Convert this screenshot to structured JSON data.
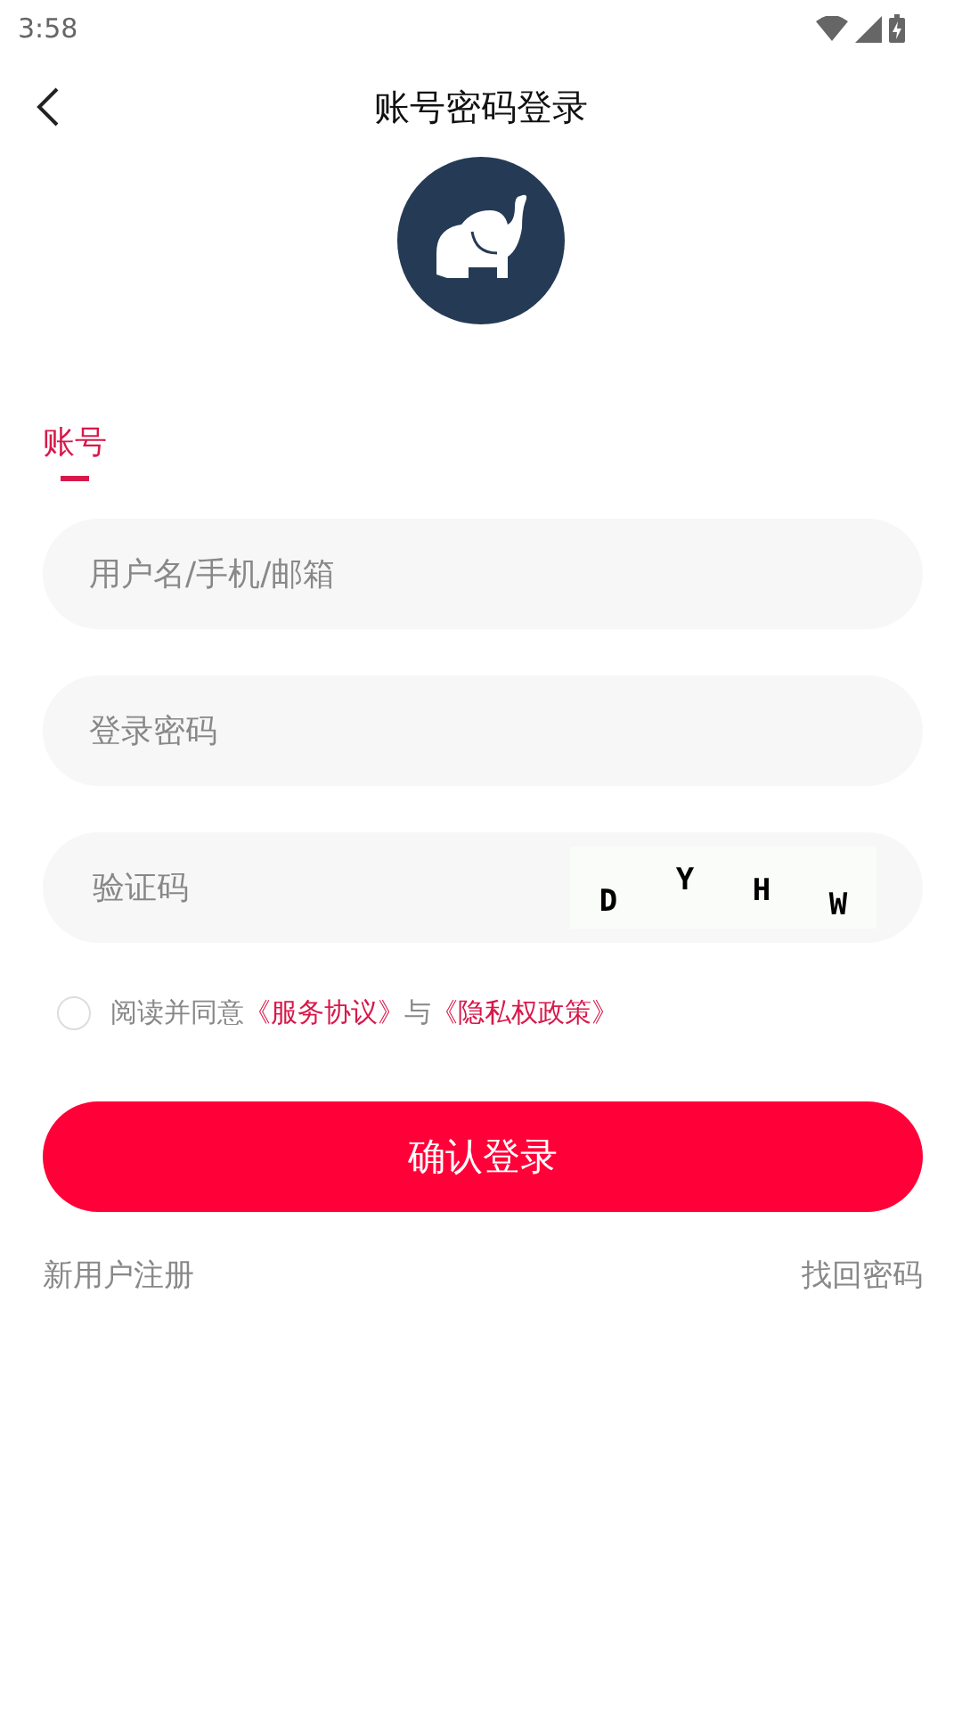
{
  "status_bar": {
    "time": "3:58"
  },
  "header": {
    "title": "账号密码登录"
  },
  "tabs": [
    {
      "label": "账号",
      "selected": true
    }
  ],
  "fields": [
    {
      "kind": "text",
      "placeholder": "用户名/手机/邮箱"
    },
    {
      "kind": "password",
      "placeholder": "登录密码"
    },
    {
      "kind": "captcha",
      "placeholder": "验证码",
      "captcha": [
        "D",
        "Y",
        "H",
        "W"
      ]
    }
  ],
  "agreement": {
    "checked": false,
    "text": "阅读并同意",
    "link_1": "《服务协议》",
    "joiner": "与",
    "link_2": "《隐私权政策》"
  },
  "submit": "确认登录",
  "footer": {
    "register": "新用户注册",
    "recover": "找回密码"
  }
}
